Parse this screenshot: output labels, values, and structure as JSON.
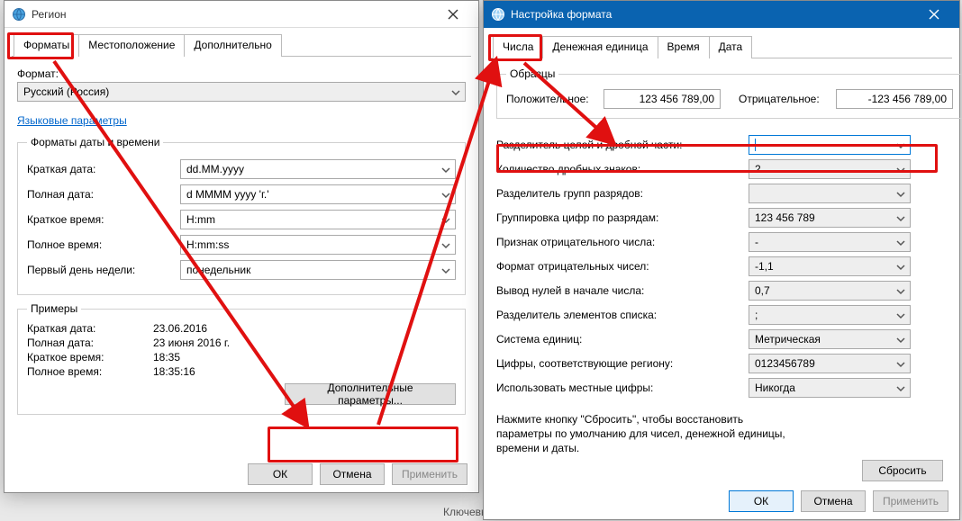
{
  "left": {
    "title": "Регион",
    "tabs": [
      "Форматы",
      "Местоположение",
      "Дополнительно"
    ],
    "format_label": "Формат:",
    "format_value": "Русский (Россия)",
    "lang_link": "Языковые параметры",
    "group_datetime": "Форматы даты и времени",
    "rows": [
      {
        "k": "Краткая дата:",
        "combo": "dd.MM.yyyy"
      },
      {
        "k": "Полная дата:",
        "combo": "d MMMM yyyy 'г.'"
      },
      {
        "k": "Краткое время:",
        "combo": "H:mm"
      },
      {
        "k": "Полное время:",
        "combo": "H:mm:ss"
      },
      {
        "k": "Первый день недели:",
        "combo": "понедельник"
      }
    ],
    "group_examples": "Примеры",
    "examples": [
      {
        "k": "Краткая дата:",
        "v": "23.06.2016"
      },
      {
        "k": "Полная дата:",
        "v": "23 июня 2016 г."
      },
      {
        "k": "Краткое время:",
        "v": "18:35"
      },
      {
        "k": "Полное время:",
        "v": "18:35:16"
      }
    ],
    "more_btn": "Дополнительные параметры...",
    "ok": "ОК",
    "cancel": "Отмена",
    "apply": "Применить"
  },
  "right": {
    "title": "Настройка формата",
    "tabs": [
      "Числа",
      "Денежная единица",
      "Время",
      "Дата"
    ],
    "samples_legend": "Образцы",
    "pos_label": "Положительное:",
    "pos_val": "123 456 789,00",
    "neg_label": "Отрицательное:",
    "neg_val": "-123 456 789,00",
    "rows": [
      {
        "k": "Разделитель целой и дробной части:",
        "v": ""
      },
      {
        "k": "Количество дробных знаков:",
        "v": "2"
      },
      {
        "k": "Разделитель групп разрядов:",
        "v": ""
      },
      {
        "k": "Группировка цифр по разрядам:",
        "v": "123 456 789"
      },
      {
        "k": "Признак отрицательного числа:",
        "v": "-"
      },
      {
        "k": "Формат отрицательных чисел:",
        "v": "-1,1"
      },
      {
        "k": "Вывод нулей в начале числа:",
        "v": "0,7"
      },
      {
        "k": "Разделитель элементов списка:",
        "v": ";"
      },
      {
        "k": "Система единиц:",
        "v": "Метрическая"
      },
      {
        "k": "Цифры, соответствующие региону:",
        "v": "0123456789"
      },
      {
        "k": "Использовать местные цифры:",
        "v": "Никогда"
      }
    ],
    "note": "Нажмите кнопку \"Сбросить\", чтобы восстановить параметры по умолчанию для чисел, денежной единицы, времени и даты.",
    "reset": "Сбросить",
    "ok": "ОК",
    "cancel": "Отмена",
    "apply": "Применить"
  },
  "background_text": "Ключевы"
}
